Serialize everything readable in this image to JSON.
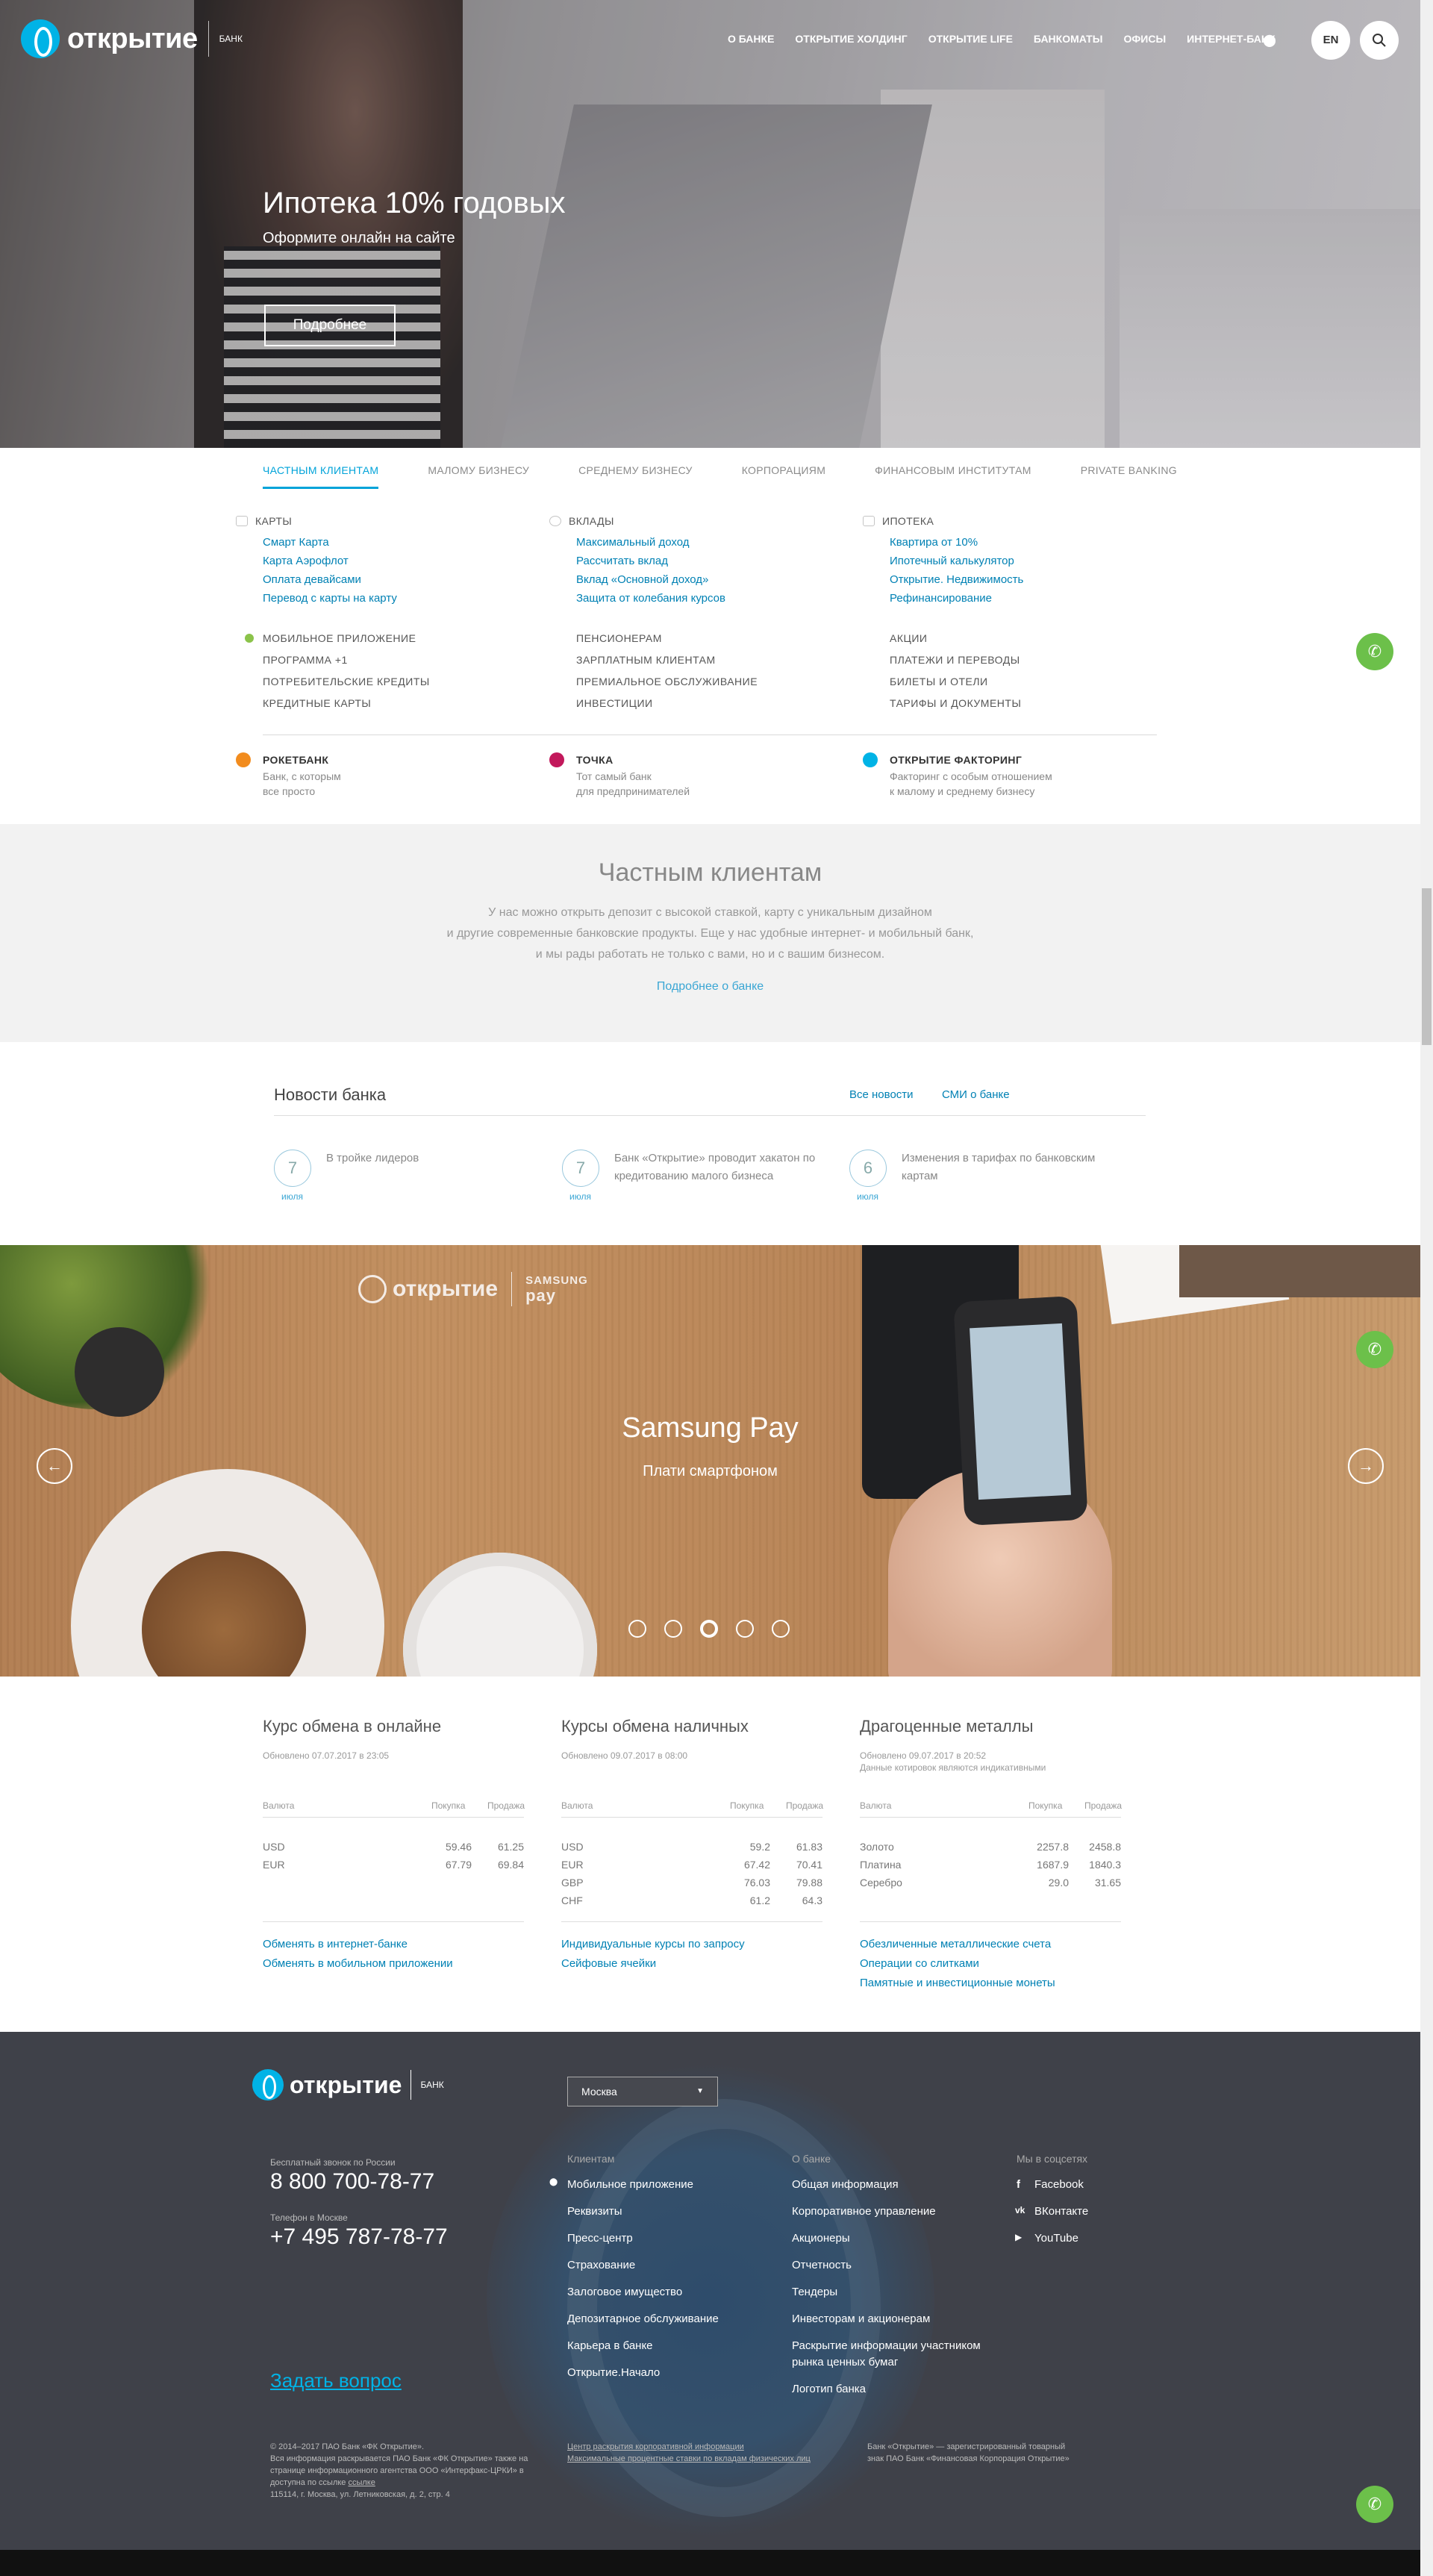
{
  "header": {
    "logo_text": "открытие",
    "logo_sub": "БАНК",
    "nav": [
      "О БАНКЕ",
      "ОТКРЫТИЕ ХОЛДИНГ",
      "ОТКРЫТИЕ LIFE",
      "БАНКОМАТЫ",
      "ОФИСЫ",
      "ИНТЕРНЕТ-БАНК"
    ],
    "lang_button": "EN",
    "os_icons": "apple-icon android-icon"
  },
  "hero": {
    "title": "Ипотека 10% годовых",
    "subtitle": "Оформите онлайн на сайте",
    "button": "Подробнее"
  },
  "tabs": [
    "ЧАСТНЫМ КЛИЕНТАМ",
    "МАЛОМУ БИЗНЕСУ",
    "СРЕДНЕМУ БИЗНЕСУ",
    "КОРПОРАЦИЯМ",
    "ФИНАНСОВЫМ ИНСТИТУТАМ",
    "PRIVATE BANKING"
  ],
  "menu": {
    "cards": {
      "title": "КАРТЫ",
      "links": [
        "Смарт Карта",
        "Карта Аэрофлот",
        "Оплата девайсами",
        "Перевод с карты на карту"
      ]
    },
    "deposits": {
      "title": "ВКЛАДЫ",
      "links": [
        "Максимальный доход",
        "Рассчитать вклад",
        "Вклад «Основной доход»",
        "Защита от колебания курсов"
      ]
    },
    "mortgage": {
      "title": "ИПОТЕКА",
      "links": [
        "Квартира от 10%",
        "Ипотечный калькулятор",
        "Открытие. Недвижимость",
        "Рефинансирование"
      ]
    },
    "col1": [
      "МОБИЛЬНОЕ ПРИЛОЖЕНИЕ",
      "ПРОГРАММА +1",
      "ПОТРЕБИТЕЛЬСКИЕ КРЕДИТЫ",
      "КРЕДИТНЫЕ КАРТЫ"
    ],
    "col2": [
      "ПЕНСИОНЕРАМ",
      "ЗАРПЛАТНЫМ КЛИЕНТАМ",
      "ПРЕМИАЛЬНОЕ ОБСЛУЖИВАНИЕ",
      "ИНВЕСТИЦИИ"
    ],
    "col3": [
      "АКЦИИ",
      "ПЛАТЕЖИ И ПЕРЕВОДЫ",
      "БИЛЕТЫ И ОТЕЛИ",
      "ТАРИФЫ И ДОКУМЕНТЫ"
    ],
    "partners": [
      {
        "title": "РОКЕТБАНК",
        "desc1": "Банк, с которым",
        "desc2": "все просто",
        "color": "#f28c1e"
      },
      {
        "title": "ТОЧКА",
        "desc1": "Тот самый банк",
        "desc2": "для предпринимателей",
        "color": "#c2185b"
      },
      {
        "title": "ОТКРЫТИЕ ФАКТОРИНГ",
        "desc1": "Факторинг с особым отношением",
        "desc2": "к малому и среднему бизнесу",
        "color": "#00b3e6"
      }
    ]
  },
  "private": {
    "title": "Частным клиентам",
    "line1": "У нас можно открыть депозит с высокой ставкой, карту с уникальным дизайном",
    "line2": "и другие современные банковские продукты. Еще у нас удобные интернет- и мобильный банк,",
    "line3": "и мы рады работать не только с вами, но и с вашим бизнесом.",
    "link": "Подробнее о банке"
  },
  "news": {
    "title": "Новости банка",
    "all_news": "Все новости",
    "media": "СМИ о банке",
    "items": [
      {
        "day": "7",
        "month": "июля",
        "text": "В тройке лидеров"
      },
      {
        "day": "7",
        "month": "июля",
        "text": "Банк «Открытие» проводит хакатон по кредитованию малого бизнеса"
      },
      {
        "day": "6",
        "month": "июля",
        "text": "Изменения в тарифах по банковским картам"
      }
    ]
  },
  "promo": {
    "logo_text": "открытие",
    "logo_sub": "БАНК",
    "samsung": "SAMSUNG",
    "pay": "pay",
    "title": "Samsung Pay",
    "subtitle": "Плати смартфоном",
    "prev": "←",
    "next": "→",
    "slides": 5,
    "active_slide": 3
  },
  "rates": {
    "online": {
      "title": "Курс обмена в онлайне",
      "updated": "Обновлено 07.07.2017 в 23:05",
      "updated2": "",
      "col_cur": "Валюта",
      "col_buy": "Покупка",
      "col_sell": "Продажа",
      "rows": [
        {
          "cur": "USD",
          "buy": "59.46",
          "sell": "61.25"
        },
        {
          "cur": "EUR",
          "buy": "67.79",
          "sell": "69.84"
        }
      ],
      "links": [
        "Обменять в интернет-банке",
        "Обменять в мобильном приложении"
      ]
    },
    "cash": {
      "title": "Курсы обмена наличных",
      "updated": "Обновлено 09.07.2017 в 08:00",
      "updated2": "",
      "col_cur": "Валюта",
      "col_buy": "Покупка",
      "col_sell": "Продажа",
      "rows": [
        {
          "cur": "USD",
          "buy": "59.2",
          "sell": "61.83"
        },
        {
          "cur": "EUR",
          "buy": "67.42",
          "sell": "70.41"
        },
        {
          "cur": "GBP",
          "buy": "76.03",
          "sell": "79.88"
        },
        {
          "cur": "CHF",
          "buy": "61.2",
          "sell": "64.3"
        }
      ],
      "links": [
        "Индивидуальные курсы по запросу",
        "Сейфовые ячейки"
      ]
    },
    "metals": {
      "title": "Драгоценные металлы",
      "updated": "Обновлено 09.07.2017 в 20:52",
      "updated2": "Данные котировок являются индикативными",
      "col_cur": "Валюта",
      "col_buy": "Покупка",
      "col_sell": "Продажа",
      "rows": [
        {
          "cur": "Золото",
          "buy": "2257.8",
          "sell": "2458.8"
        },
        {
          "cur": "Платина",
          "buy": "1687.9",
          "sell": "1840.3"
        },
        {
          "cur": "Серебро",
          "buy": "29.0",
          "sell": "31.65"
        }
      ],
      "links": [
        "Обезличенные металлические счета",
        "Операции со слитками",
        "Памятные и инвестиционные монеты"
      ]
    }
  },
  "footer": {
    "logo_text": "открытие",
    "logo_sub": "БАНК",
    "city": "Москва",
    "free_call_label": "Бесплатный звонок по России",
    "free_call": "8 800 700-78-77",
    "moscow_label": "Телефон в Москве",
    "moscow_phone": "+7 495 787-78-77",
    "clients_title": "Клиентам",
    "clients": [
      "Мобильное приложение",
      "Реквизиты",
      "Пресс-центр",
      "Страхование",
      "Залоговое имущество",
      "Депозитарное обслуживание",
      "Карьера в банке",
      "Открытие.Начало"
    ],
    "about_title": "О банке",
    "about": [
      "Общая информация",
      "Корпоративное управление",
      "Акционеры",
      "Отчетность",
      "Тендеры",
      "Инвесторам и акционерам",
      "Раскрытие информации участником",
      "рынка ценных бумаг",
      "Логотип банка"
    ],
    "social_title": "Мы в соцсетях",
    "social": [
      "Facebook",
      "ВКонтакте",
      "YouTube"
    ],
    "ask": "Задать вопрос",
    "legal1": [
      "© 2014–2017 ПАО Банк «ФК Открытие».",
      "Вся информация раскрывается ПАО Банк «ФК Открытие» также на",
      "странице информационного агентства ООО «Интерфакс-ЦРКИ» в",
      "доступна по ссылке",
      "115114, г. Москва, ул. Летниковская, д. 2, стр. 4"
    ],
    "legal1_link": "ссылке",
    "legal2": [
      "Центр раскрытия корпоративной информации",
      "Максимальные процентные ставки по вкладам физических лиц"
    ],
    "legal3": [
      "Банк «Открытие» — зарегистрированный товарный",
      "знак ПАО Банк «Финансовая Корпорация Открытие»"
    ]
  }
}
